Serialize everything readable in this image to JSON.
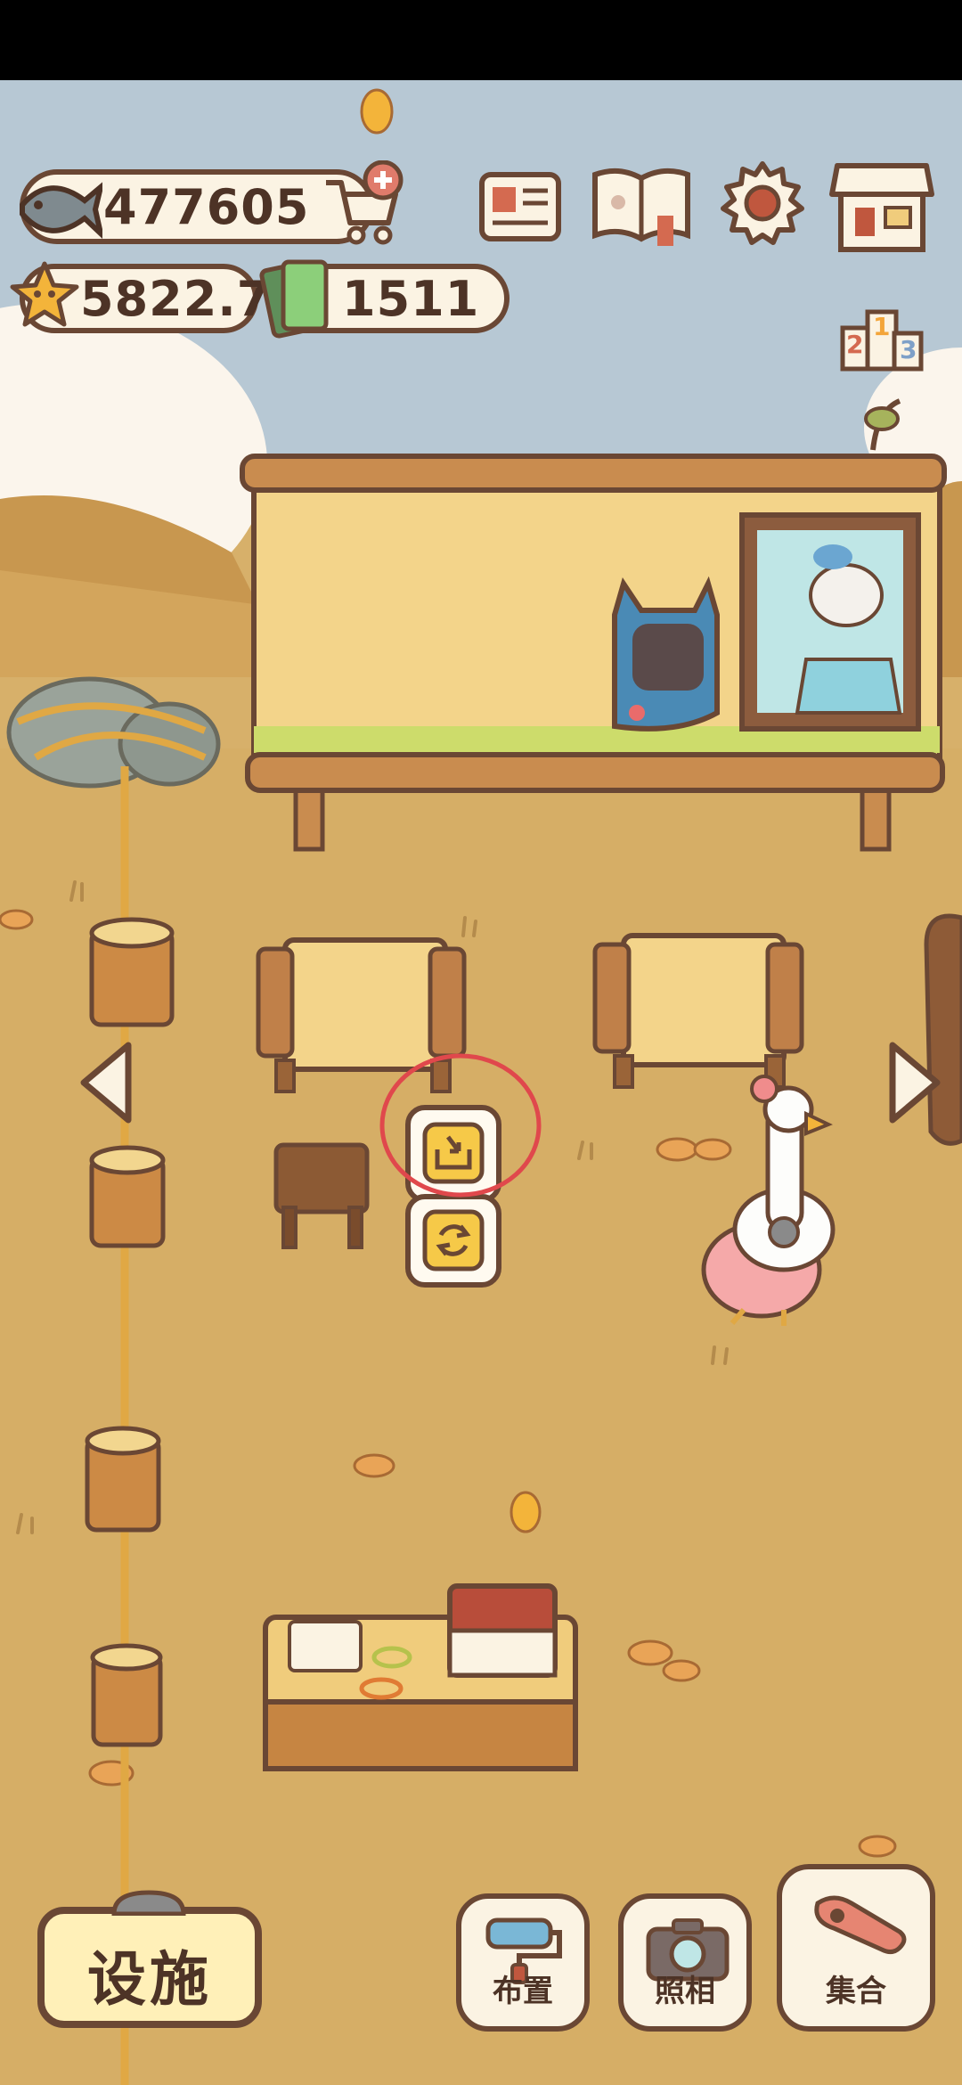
{
  "currencies": {
    "fish": "477605",
    "stars": "5822.7",
    "tickets": "1511"
  },
  "bottom_bar": {
    "facility_label": "设施",
    "layout_label": "布置",
    "photo_label": "照相",
    "gather_label": "集合"
  },
  "leaderboard": {
    "left": "2",
    "center": "1",
    "right": "3"
  },
  "icons": {
    "fish": "fish-icon",
    "cart": "cart-add-icon",
    "star": "star-icon",
    "ticket": "ticket-icon",
    "news": "newspaper-icon",
    "book": "paw-book-icon",
    "settings": "gear-icon",
    "shop": "shop-icon",
    "ranking": "podium-icon",
    "store_item": "store-item-icon",
    "rotate": "rotate-icon",
    "roller": "paint-roller-icon",
    "camera": "camera-icon",
    "whistle": "whistle-icon"
  },
  "colors": {
    "outline": "#6a4734",
    "cream": "#fbf3e3",
    "ground": "#d7b06a",
    "sky": "#b7c8d4",
    "highlight_circle": "#e0484c",
    "button_yellow": "#f6c948"
  }
}
